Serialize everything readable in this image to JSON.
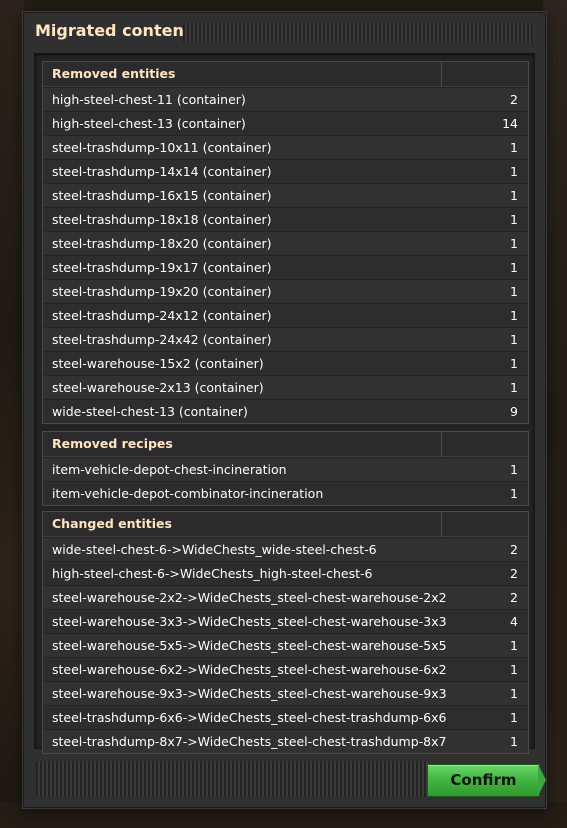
{
  "dialog": {
    "title": "Migrated content",
    "confirm_label": "Confirm"
  },
  "sections": {
    "removed_entities": {
      "header": "Removed entities",
      "rows": [
        {
          "name": "high-steel-chest-11 (container)",
          "count": "2"
        },
        {
          "name": "high-steel-chest-13 (container)",
          "count": "14"
        },
        {
          "name": "steel-trashdump-10x11 (container)",
          "count": "1"
        },
        {
          "name": "steel-trashdump-14x14 (container)",
          "count": "1"
        },
        {
          "name": "steel-trashdump-16x15 (container)",
          "count": "1"
        },
        {
          "name": "steel-trashdump-18x18 (container)",
          "count": "1"
        },
        {
          "name": "steel-trashdump-18x20 (container)",
          "count": "1"
        },
        {
          "name": "steel-trashdump-19x17 (container)",
          "count": "1"
        },
        {
          "name": "steel-trashdump-19x20 (container)",
          "count": "1"
        },
        {
          "name": "steel-trashdump-24x12 (container)",
          "count": "1"
        },
        {
          "name": "steel-trashdump-24x42 (container)",
          "count": "1"
        },
        {
          "name": "steel-warehouse-15x2 (container)",
          "count": "1"
        },
        {
          "name": "steel-warehouse-2x13 (container)",
          "count": "1"
        },
        {
          "name": "wide-steel-chest-13 (container)",
          "count": "9"
        }
      ]
    },
    "removed_recipes": {
      "header": "Removed recipes",
      "rows": [
        {
          "name": "item-vehicle-depot-chest-incineration",
          "count": "1"
        },
        {
          "name": "item-vehicle-depot-combinator-incineration",
          "count": "1"
        }
      ]
    },
    "changed_entities": {
      "header": "Changed entities",
      "rows": [
        {
          "name": "wide-steel-chest-6->WideChests_wide-steel-chest-6",
          "count": "2"
        },
        {
          "name": "high-steel-chest-6->WideChests_high-steel-chest-6",
          "count": "2"
        },
        {
          "name": "steel-warehouse-2x2->WideChests_steel-chest-warehouse-2x2",
          "count": "2"
        },
        {
          "name": "steel-warehouse-3x3->WideChests_steel-chest-warehouse-3x3",
          "count": "4"
        },
        {
          "name": "steel-warehouse-5x5->WideChests_steel-chest-warehouse-5x5",
          "count": "1"
        },
        {
          "name": "steel-warehouse-6x2->WideChests_steel-chest-warehouse-6x2",
          "count": "1"
        },
        {
          "name": "steel-warehouse-9x3->WideChests_steel-chest-warehouse-9x3",
          "count": "1"
        },
        {
          "name": "steel-trashdump-6x6->WideChests_steel-chest-trashdump-6x6",
          "count": "1"
        },
        {
          "name": "steel-trashdump-8x7->WideChests_steel-chest-trashdump-8x7",
          "count": "1"
        }
      ]
    }
  },
  "colors": {
    "header_text": "#ffe6c0",
    "confirm_button": "#42b642",
    "panel": "#313031"
  }
}
